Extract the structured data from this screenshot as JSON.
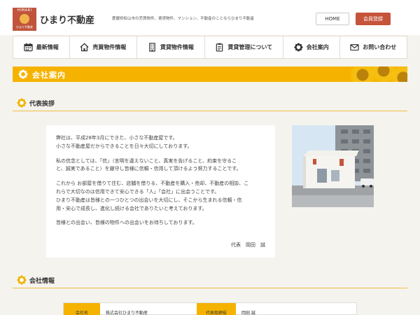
{
  "header": {
    "logo_top": "HIMARI",
    "logo_bottom": "ひまり不動産",
    "site_name": "ひまり不動産",
    "tagline": "愛媛県松山市の売買物件、賃貸物件、マンション、不動産のことならひまり不動産",
    "home_label": "HOME",
    "member_label": "会員登録",
    "accent_color": "#c5543a"
  },
  "nav": {
    "items": [
      {
        "label": "最新情報",
        "icon": "calendar-icon"
      },
      {
        "label": "売買物件情報",
        "icon": "house-icon"
      },
      {
        "label": "賃貸物件情報",
        "icon": "building-icon"
      },
      {
        "label": "賃貸管理について",
        "icon": "clipboard-icon"
      },
      {
        "label": "会社案内",
        "icon": "flower-icon"
      },
      {
        "label": "お問い合わせ",
        "icon": "mail-icon"
      }
    ]
  },
  "page": {
    "title": "会社案内",
    "banner_color": "#f5b300"
  },
  "greeting": {
    "heading": "代表挨拶",
    "paragraphs": [
      [
        "弊社は、平成28年3月にできた、小さな不動産屋です。",
        "小さな不動産屋だからできることを日々大切にしております。"
      ],
      [
        "私の信念としては、「信」（言明を違えないこと、真実を告げること、約束を守るこ",
        "と、誠実であること）を厳守し皆様に信頼・信用して頂けるよう努力することです。"
      ],
      [
        "これから お部屋を借りて住む、店舗を借りる、不動産を購入・売却、不動産の相談、こ",
        "れらで大切なのは信用できて安心できる「人」「会社」に出会うことです。",
        "ひまり不動産は皆様との一つひとつの出会いを大切にし、そこから生まれる信頼・信",
        "用・安心で成長し、進化し続ける会社でありたいと考えております。"
      ],
      [
        "皆様との出会い、皆様の物件への出会いをお待ちしております。"
      ]
    ],
    "signature": "代表　岡田　誠"
  },
  "company": {
    "heading": "会社情報",
    "rows": [
      {
        "label": "会社名",
        "value": "株式会社ひまり不動産"
      },
      {
        "label": "代表取締役",
        "value": "岡田 誠"
      }
    ]
  }
}
